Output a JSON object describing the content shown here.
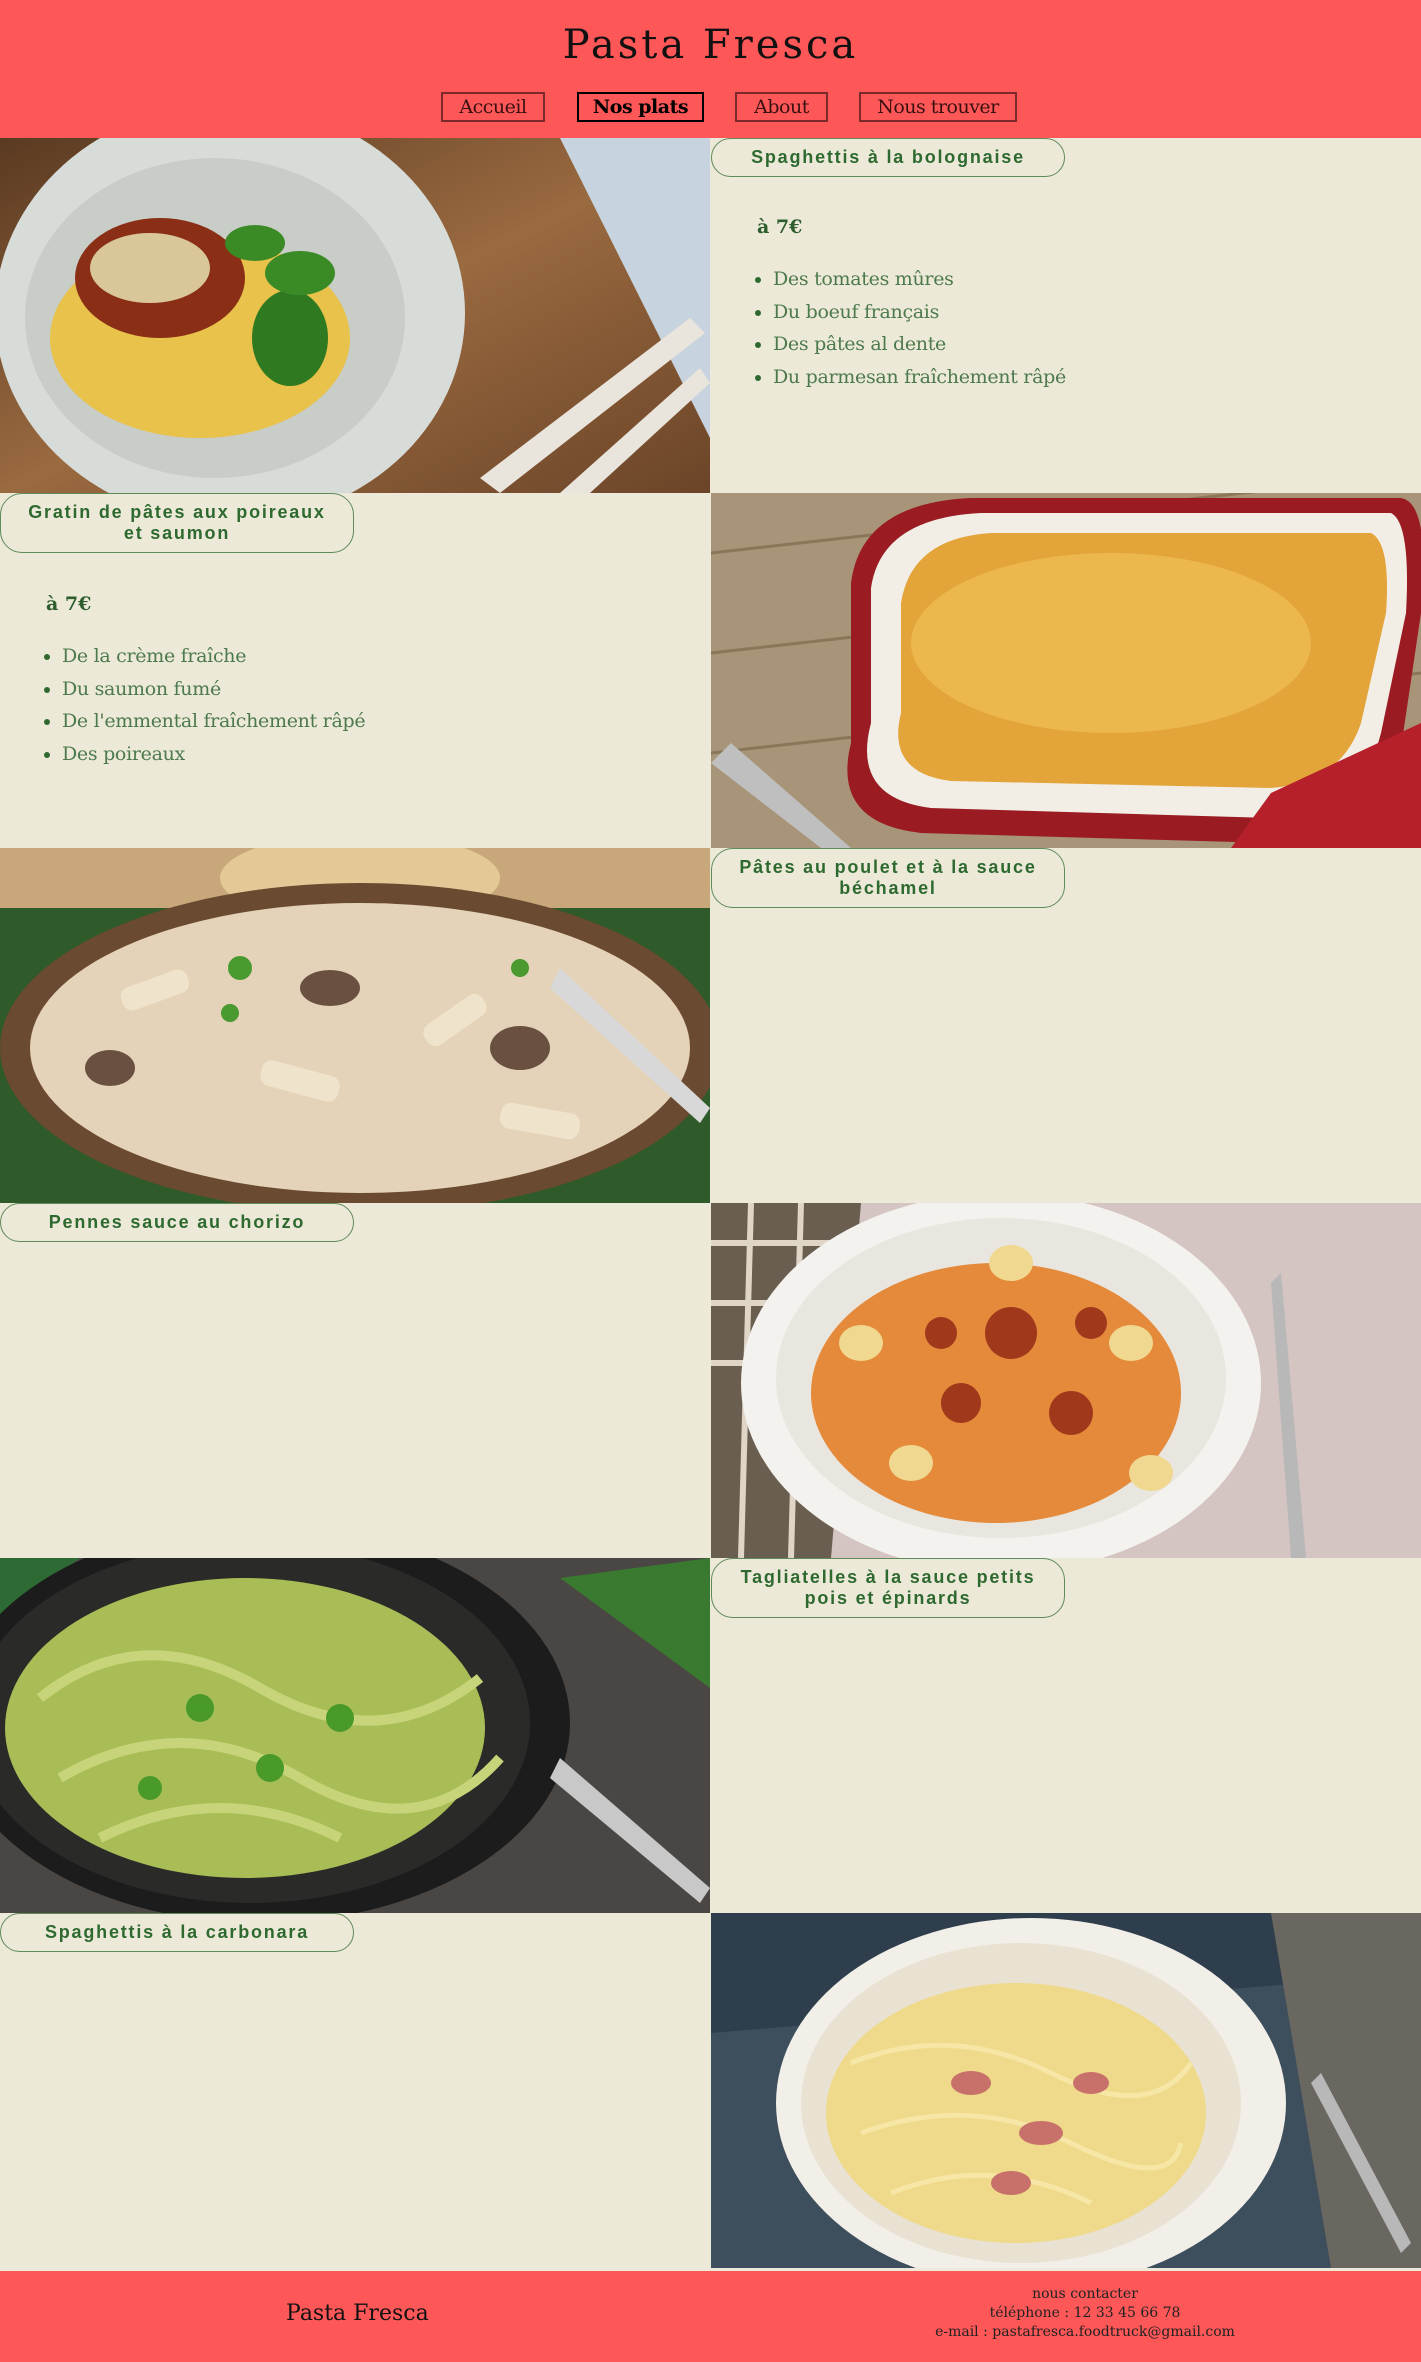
{
  "header": {
    "title": "Pasta Fresca",
    "nav": [
      {
        "label": "Accueil",
        "active": false
      },
      {
        "label": "Nos plats",
        "active": true
      },
      {
        "label": "About",
        "active": false
      },
      {
        "label": "Nous trouver",
        "active": false
      }
    ]
  },
  "dishes": [
    {
      "name": "Spaghettis à la bolognaise",
      "price": "à 7€",
      "ingredients": [
        "Des tomates mûres",
        "Du boeuf français",
        "Des pâtes al dente",
        "Du parmesan fraîchement râpé"
      ]
    },
    {
      "name": "Gratin de pâtes aux poireaux et saumon",
      "price": "à 7€",
      "ingredients": [
        "De la crème fraîche",
        "Du saumon fumé",
        "De l'emmental fraîchement râpé",
        "Des poireaux"
      ]
    },
    {
      "name": "Pâtes au poulet et à la sauce béchamel"
    },
    {
      "name": "Pennes sauce au chorizo"
    },
    {
      "name": "Tagliatelles à la sauce petits pois et épinards"
    },
    {
      "name": "Spaghettis à la carbonara"
    }
  ],
  "footer": {
    "brand": "Pasta Fresca",
    "contact_title": "nous contacter",
    "phone": "téléphone : 12 33 45 66 78",
    "email": "e-mail : pastafresca.foodtruck@gmail.com"
  },
  "colors": {
    "header_bg": "#fd5758",
    "page_bg": "#ede9d8",
    "accent_green": "#2e6a30"
  },
  "icons": [
    "bolognese-photo",
    "gratin-photo",
    "penne-chicken-photo",
    "chorizo-pasta-photo",
    "pesto-tagliatelle-photo",
    "carbonara-photo"
  ]
}
